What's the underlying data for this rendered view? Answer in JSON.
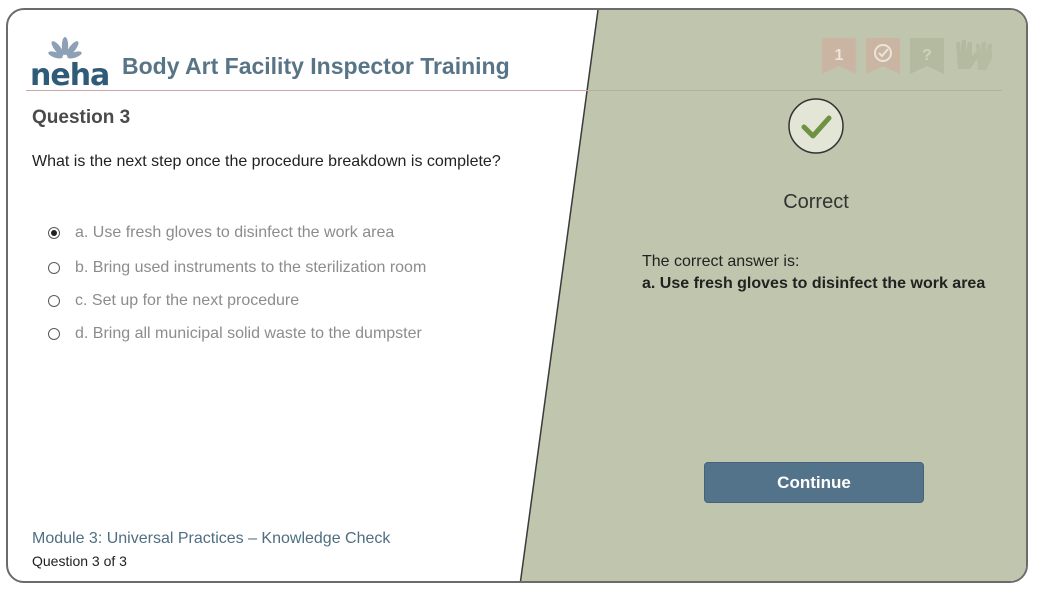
{
  "brand": {
    "logo_text": "neha"
  },
  "course": {
    "title": "Body Art Facility Inspector Training"
  },
  "question": {
    "heading": "Question 3",
    "text": "What is the next step once the procedure breakdown is complete?",
    "options": [
      {
        "label": "a. Use fresh gloves to disinfect the work area",
        "selected": true
      },
      {
        "label": "b. Bring used instruments to the sterilization room",
        "selected": false
      },
      {
        "label": "c. Set up for the next procedure",
        "selected": false
      },
      {
        "label": "d. Bring all municipal solid waste to the dumpster",
        "selected": false
      }
    ]
  },
  "footer": {
    "module": "Module 3: Universal Practices – Knowledge Check",
    "progress": "Question 3 of 3"
  },
  "status_icons": {
    "badge_number": "1",
    "icons": [
      "ribbon-number-icon",
      "ribbon-check-icon",
      "ribbon-question-icon",
      "gloves-icon"
    ]
  },
  "feedback": {
    "result": "Correct",
    "answer_intro": "The correct answer is:",
    "answer_value": "a. Use fresh gloves to disinfect the work area",
    "continue_label": "Continue"
  },
  "colors": {
    "feedback_panel": "#c0c5ad",
    "accent_blue": "#52738a",
    "check_green": "#6f9142"
  }
}
